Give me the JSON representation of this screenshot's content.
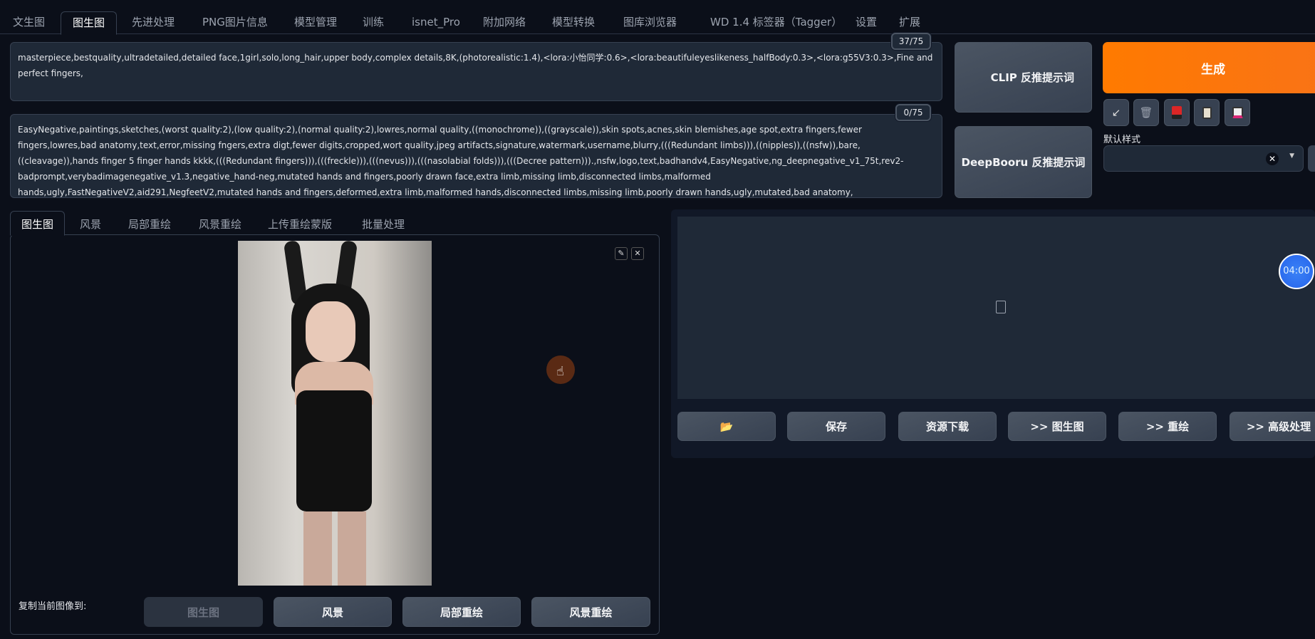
{
  "top_tabs": [
    "文生图",
    "图生图",
    "先进处理",
    "PNG图片信息",
    "模型管理",
    "训练",
    "isnet_Pro",
    "附加网络",
    "模型转换",
    "图库浏览器",
    "WD 1.4 标签器（Tagger）",
    "设置",
    "扩展"
  ],
  "active_top_tab": "图生图",
  "prompt": {
    "value": "masterpiece,bestquality,ultradetailed,detailed face,1girl,solo,long_hair,upper body,complex details,8K,(photorealistic:1.4),<lora:小怡同学:0.6>,<lora:beautifuleyeslikeness_halfBody:0.3>,<lora:g55V3:0.3>,Fine and perfect fingers,",
    "counter": "37/75"
  },
  "negative_prompt": {
    "value": "EasyNegative,paintings,sketches,(worst quality:2),(low quality:2),(normal quality:2),lowres,normal quality,((monochrome)),((grayscale)),skin spots,acnes,skin blemishes,age spot,extra fingers,fewer fingers,lowres,bad anatomy,text,error,missing fngers,extra digt,fewer digits,cropped,wort quality,jpeg artifacts,signature,watermark,username,blurry,(((Redundant limbs))),((nipples)),((nsfw)),bare,((cleavage)),hands finger 5 finger hands kkkk,(((Redundant fingers))),(((freckle))),(((nevus))),(((nasolabial folds))),(((Decree pattern))).,nsfw,logo,text,badhandv4,EasyNegative,ng_deepnegative_v1_75t,rev2-badprompt,verybadimagenegative_v1.3,negative_hand-neg,mutated hands and fingers,poorly drawn face,extra limb,missing limb,disconnected limbs,malformed hands,ugly,FastNegativeV2,aid291,NegfeetV2,mutated hands and fingers,deformed,extra limb,malformed hands,disconnected limbs,missing limb,poorly drawn hands,ugly,mutated,bad anatomy,",
    "counter": "0/75"
  },
  "interrogate": {
    "clip": "CLIP 反推提示词",
    "deepbooru": "DeepBooru 反推提示词"
  },
  "generate": {
    "label": "生成",
    "color": "#ff7a00"
  },
  "tool_icons": [
    "arrow-icon",
    "trash-icon",
    "red-card-icon",
    "clipboard-icon",
    "save-icon"
  ],
  "styles": {
    "label": "默认样式",
    "value": ""
  },
  "sub_tabs": [
    "图生图",
    "风景",
    "局部重绘",
    "风景重绘",
    "上传重绘蒙版",
    "批量处理"
  ],
  "active_sub_tab": "图生图",
  "copy_to": {
    "label": "复制当前图像到:",
    "buttons": [
      "图生图",
      "风景",
      "局部重绘",
      "风景重绘"
    ]
  },
  "output_buttons": [
    "📂",
    "保存",
    "资源下载",
    ">> 图生图",
    ">> 重绘",
    ">> 高级处理"
  ],
  "timer": "04:00"
}
